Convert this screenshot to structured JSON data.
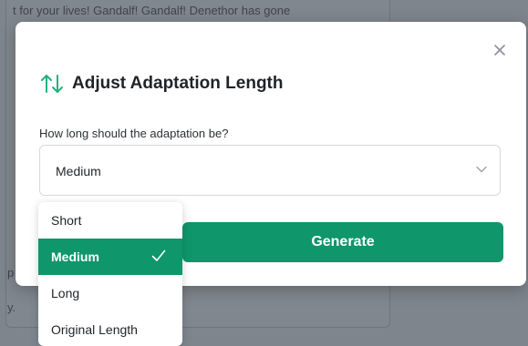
{
  "background": {
    "top_text": "t for your lives! Gandalf! Gandalf! Denethor has gone",
    "side_text_1": "p",
    "side_text_2": "y."
  },
  "modal": {
    "title": "Adjust Adaptation Length",
    "icon": "arrows-up-down-icon",
    "close_icon": "close-icon",
    "field_label": "How long should the adaptation be?",
    "select": {
      "value": "Medium",
      "icon": "chevron-down-icon"
    },
    "generate_label": "Generate"
  },
  "dropdown": {
    "options": [
      {
        "label": "Short",
        "selected": false
      },
      {
        "label": "Medium",
        "selected": true
      },
      {
        "label": "Long",
        "selected": false
      },
      {
        "label": "Original Length",
        "selected": false
      }
    ]
  },
  "colors": {
    "accent": "#0f966a",
    "overlay": "#7e858d",
    "title_icon": "#22b07d"
  }
}
